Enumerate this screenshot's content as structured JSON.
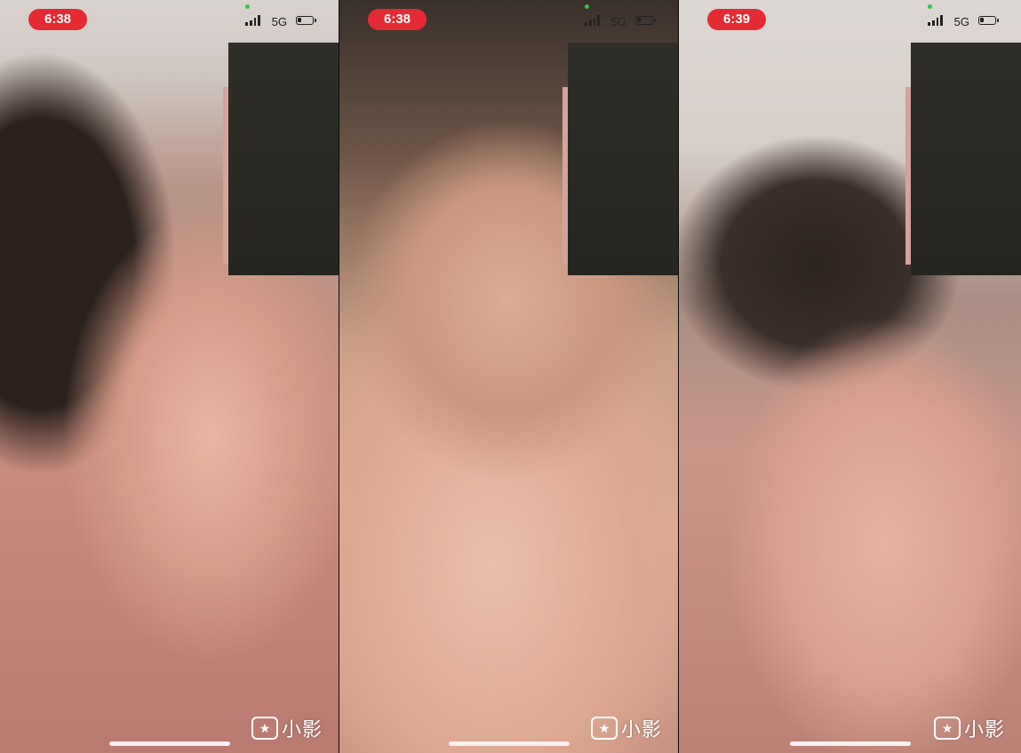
{
  "screens": [
    {
      "time": "6:38",
      "network": "5G"
    },
    {
      "time": "6:38",
      "network": "5G"
    },
    {
      "time": "6:39",
      "network": "5G"
    }
  ],
  "watermark": {
    "text": "小影",
    "icon": "xiaoying-logo-icon"
  }
}
